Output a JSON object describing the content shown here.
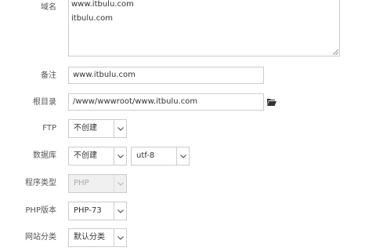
{
  "form": {
    "domain": {
      "label": "域名",
      "lines": [
        "www.itbulu.com",
        "itbulu.com"
      ]
    },
    "remark": {
      "label": "备注",
      "value": "www.itbulu.com"
    },
    "root_dir": {
      "label": "根目录",
      "value": "/www/wwwroot/www.itbulu.com"
    },
    "ftp": {
      "label": "FTP",
      "value": "不创建"
    },
    "database": {
      "label": "数据库",
      "value": "不创建",
      "charset": "utf-8"
    },
    "program_type": {
      "label": "程序类型",
      "value": "PHP"
    },
    "php_version": {
      "label": "PHP版本",
      "value": "PHP-73"
    },
    "site_category": {
      "label": "网站分类",
      "value": "默认分类"
    }
  },
  "icons": {
    "folder": "folder-open-icon",
    "dropdown": "chevron-down-icon",
    "resize": "resize-grip-icon"
  },
  "colors": {
    "border": "#cccccc",
    "label_text": "#555555",
    "disabled_bg": "#f0f0f0"
  }
}
